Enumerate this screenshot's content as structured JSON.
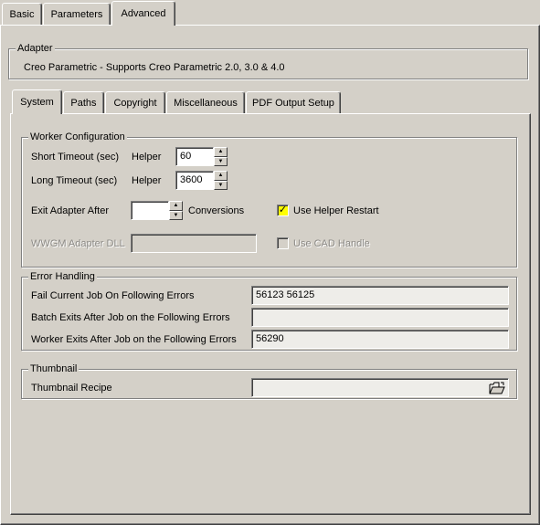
{
  "top_tabs": [
    {
      "label": "Basic"
    },
    {
      "label": "Parameters"
    },
    {
      "label": "Advanced",
      "active": true
    }
  ],
  "adapter": {
    "title": "Adapter",
    "description": "Creo Parametric  -  Supports Creo Parametric 2.0, 3.0 & 4.0"
  },
  "sub_tabs": [
    {
      "label": "System",
      "active": true
    },
    {
      "label": "Paths"
    },
    {
      "label": "Copyright"
    },
    {
      "label": "Miscellaneous"
    },
    {
      "label": "PDF Output Setup"
    }
  ],
  "worker_config": {
    "title": "Worker Configuration",
    "short_timeout_label": "Short Timeout (sec)",
    "short_helper_label": "Helper",
    "short_timeout_value": "60",
    "long_timeout_label": "Long Timeout (sec)",
    "long_helper_label": "Helper",
    "long_timeout_value": "3600",
    "exit_after_label": "Exit Adapter After",
    "exit_after_value": "",
    "conversions_label": "Conversions",
    "use_helper_restart_label": "Use Helper Restart",
    "use_helper_restart_checked": true,
    "wwgm_dll_label": "WWGM Adapter DLL",
    "wwgm_dll_value": "",
    "use_cad_handle_label": "Use CAD Handle",
    "use_cad_handle_checked": false
  },
  "error_handling": {
    "title": "Error Handling",
    "fail_job_label": "Fail Current Job On Following Errors",
    "fail_job_value": "56123 56125",
    "batch_exits_label": "Batch Exits After Job on the Following Errors",
    "batch_exits_value": "",
    "worker_exits_label": "Worker Exits After Job on the Following Errors",
    "worker_exits_value": "56290"
  },
  "thumbnail": {
    "title": "Thumbnail",
    "recipe_label": "Thumbnail Recipe",
    "recipe_value": "",
    "browse_icon": "folder-open-icon"
  },
  "colors": {
    "window_bg": "#d4d0c8",
    "checkbox_checked_bg": "#ffff00"
  }
}
